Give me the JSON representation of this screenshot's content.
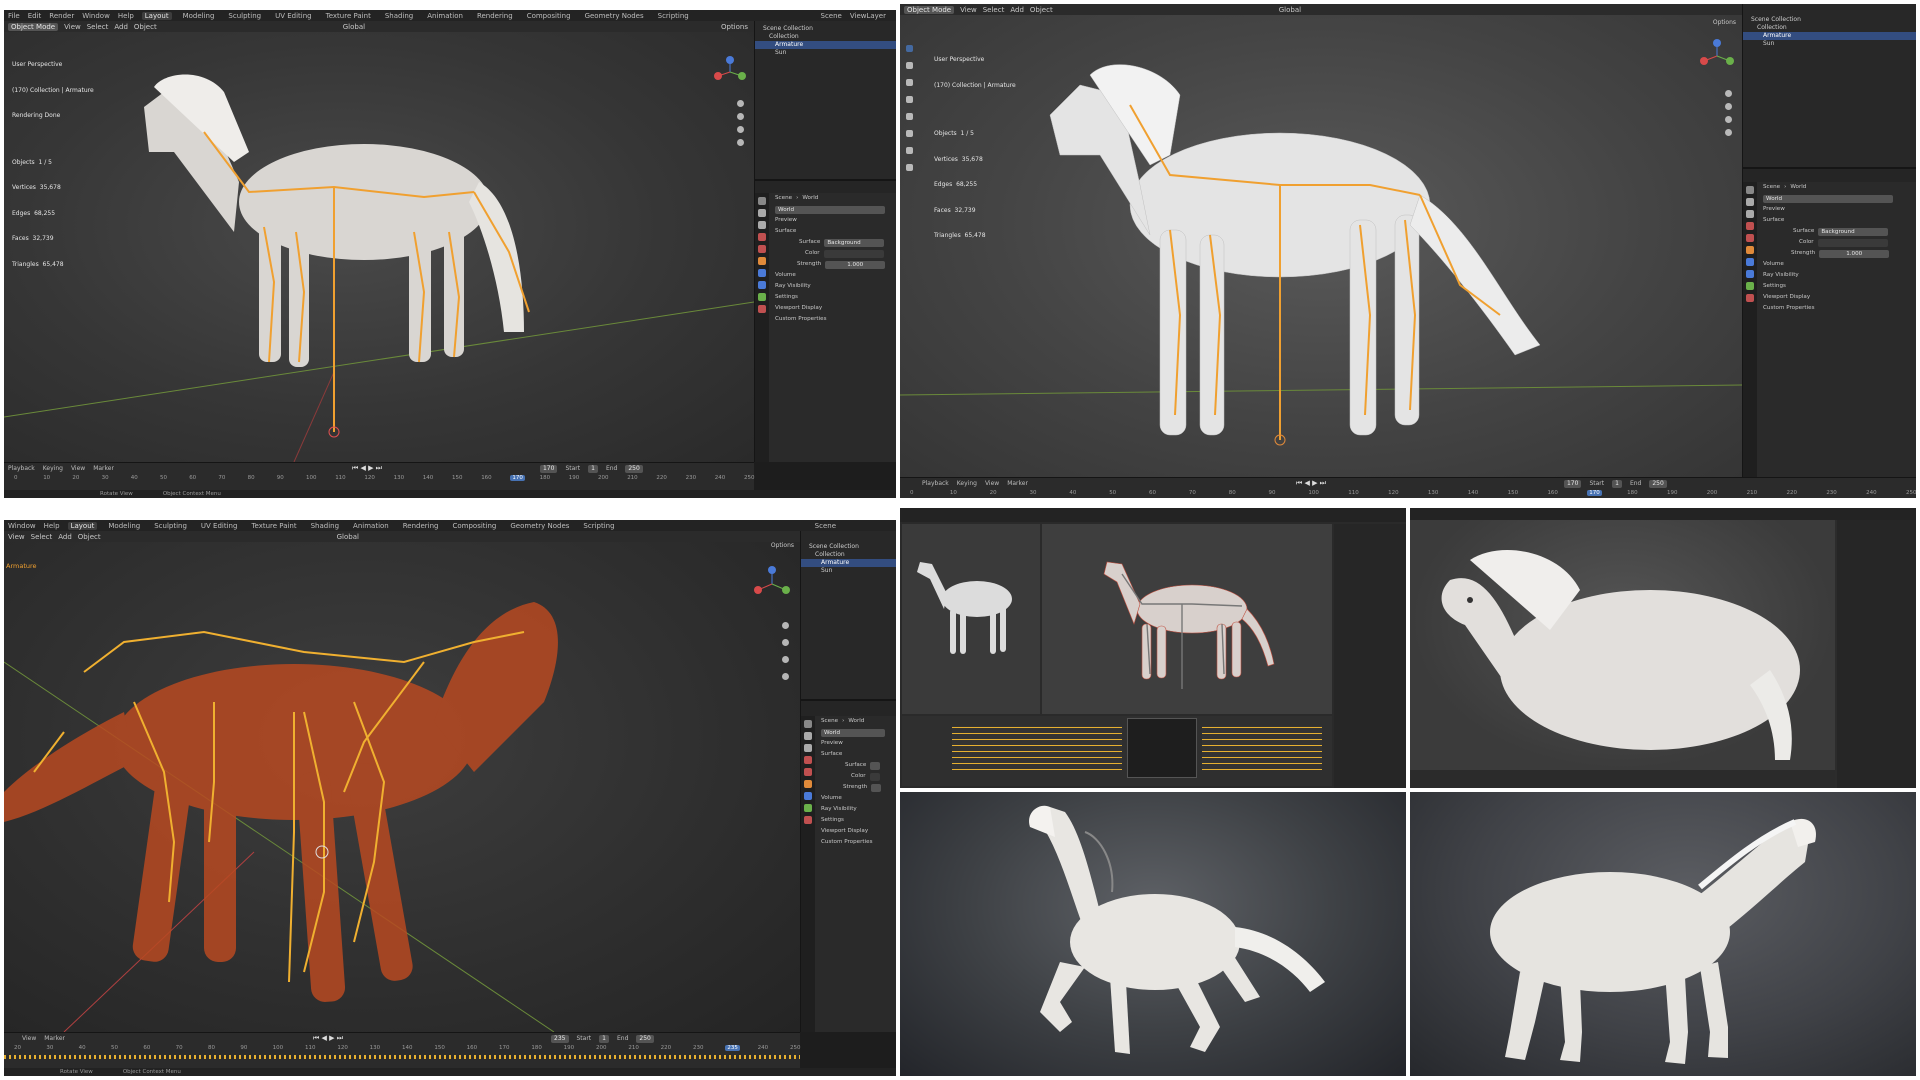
{
  "panel1": {
    "menu": [
      "File",
      "Edit",
      "Render",
      "Window",
      "Help"
    ],
    "workspaces": [
      "Layout",
      "Modeling",
      "Sculpting",
      "UV Editing",
      "Texture Paint",
      "Shading",
      "Animation",
      "Rendering",
      "Compositing",
      "Geometry Nodes",
      "Scripting"
    ],
    "active_workspace": "Layout",
    "scene": "Scene",
    "view_layer": "ViewLayer",
    "header": [
      "Object Mode",
      "View",
      "Select",
      "Add",
      "Object"
    ],
    "transform": "Global",
    "options": "Options",
    "overlay_title": "User Perspective",
    "overlay_collection": "(170) Collection | Armature",
    "overlay_status": "Rendering Done",
    "stats": [
      {
        "label": "Objects",
        "value": "1 / 5"
      },
      {
        "label": "Vertices",
        "value": "35,678"
      },
      {
        "label": "Edges",
        "value": "68,255"
      },
      {
        "label": "Faces",
        "value": "32,739"
      },
      {
        "label": "Triangles",
        "value": "65,478"
      }
    ],
    "outliner": [
      "Scene Collection",
      "Collection",
      "Armature",
      "Sun"
    ],
    "breadcrumb": [
      "Scene",
      "World"
    ],
    "world": "World",
    "props": [
      "Preview",
      "Surface",
      "Volume",
      "Ray Visibility",
      "Settings",
      "Viewport Display",
      "Custom Properties"
    ],
    "surface_label": "Surface",
    "surface_value": "Background",
    "color_label": "Color",
    "strength_label": "Strength",
    "strength_value": "1.000",
    "timeline_menu": [
      "Playback",
      "Keying",
      "View",
      "Marker"
    ],
    "current_frame": "170",
    "start_label": "Start",
    "start_value": "1",
    "end_label": "End",
    "end_value": "250",
    "frame_ticks": [
      "0",
      "10",
      "20",
      "30",
      "40",
      "50",
      "60",
      "70",
      "80",
      "90",
      "100",
      "110",
      "120",
      "130",
      "140",
      "150",
      "160",
      "170",
      "180",
      "190",
      "200",
      "210",
      "220",
      "230",
      "240",
      "250"
    ],
    "status_left": "Rotate View",
    "status_right": "Object Context Menu"
  },
  "panel2": {
    "header": [
      "Object Mode",
      "View",
      "Select",
      "Add",
      "Object"
    ],
    "transform": "Global",
    "options": "Options",
    "overlay_title": "User Perspective",
    "overlay_collection": "(170) Collection | Armature",
    "stats": [
      {
        "label": "Objects",
        "value": "1 / 5"
      },
      {
        "label": "Vertices",
        "value": "35,678"
      },
      {
        "label": "Edges",
        "value": "68,255"
      },
      {
        "label": "Faces",
        "value": "32,739"
      },
      {
        "label": "Triangles",
        "value": "65,478"
      }
    ],
    "outliner": [
      "Scene Collection",
      "Collection",
      "Armature",
      "Sun"
    ],
    "breadcrumb": [
      "Scene",
      "World"
    ],
    "world": "World",
    "props": [
      "Preview",
      "Surface",
      "Volume",
      "Ray Visibility",
      "Settings",
      "Viewport Display",
      "Custom Properties"
    ],
    "surface_label": "Surface",
    "surface_value": "Background",
    "color_label": "Color",
    "strength_label": "Strength",
    "strength_value": "1.000",
    "timeline_menu": [
      "Playback",
      "Keying",
      "View",
      "Marker"
    ],
    "current_frame": "170",
    "start_label": "Start",
    "start_value": "1",
    "end_label": "End",
    "end_value": "250",
    "frame_ticks": [
      "0",
      "10",
      "20",
      "30",
      "40",
      "50",
      "60",
      "70",
      "80",
      "90",
      "100",
      "110",
      "120",
      "130",
      "140",
      "150",
      "160",
      "170",
      "180",
      "190",
      "200",
      "210",
      "220",
      "230",
      "240",
      "250"
    ]
  },
  "panel3": {
    "menu": [
      "Window",
      "Help"
    ],
    "workspaces": [
      "Layout",
      "Modeling",
      "Sculpting",
      "UV Editing",
      "Texture Paint",
      "Shading",
      "Animation",
      "Rendering",
      "Compositing",
      "Geometry Nodes",
      "Scripting"
    ],
    "active_workspace": "Layout",
    "scene": "Scene",
    "header": [
      "View",
      "Select",
      "Add",
      "Object"
    ],
    "transform": "Global",
    "options": "Options",
    "overlay_label": "Armature",
    "outliner": [
      "Scene Collection",
      "Collection",
      "Armature",
      "Sun"
    ],
    "breadcrumb": [
      "Scene",
      "World"
    ],
    "world": "World",
    "props": [
      "Preview",
      "Surface",
      "Volume",
      "Ray Visibility",
      "Settings",
      "Viewport Display",
      "Custom Properties"
    ],
    "surface_label": "Surface",
    "color_label": "Color",
    "strength_label": "Strength",
    "timeline_menu": [
      "View",
      "Marker"
    ],
    "current_frame": "235",
    "start_label": "Start",
    "start_value": "1",
    "end_label": "End",
    "end_value": "250",
    "frame_ticks": [
      "20",
      "30",
      "40",
      "50",
      "60",
      "70",
      "80",
      "90",
      "100",
      "110",
      "120",
      "130",
      "140",
      "150",
      "160",
      "170",
      "180",
      "190",
      "200",
      "210",
      "220",
      "230",
      "235",
      "240",
      "250"
    ],
    "status_left": "Rotate View",
    "status_right": "Object Context Menu"
  },
  "colors": {
    "bone": "#f0a030",
    "wire": "#d8582a",
    "select": "#334d80",
    "frame": "#4772b3"
  }
}
